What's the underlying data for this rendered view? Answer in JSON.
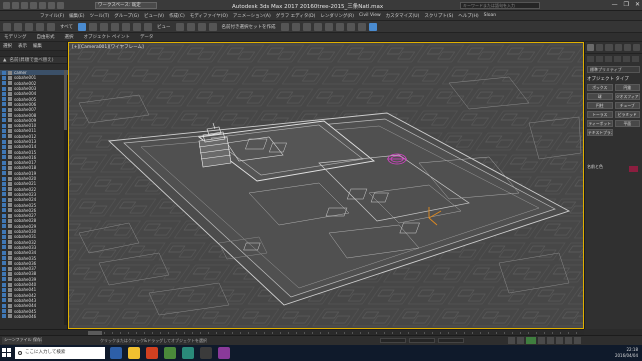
{
  "window": {
    "title": "Autodesk 3ds Max 2017    20160tree-2015_三条Natl.max",
    "workspace_label": "ワークスペース: 既定",
    "search_placeholder": "キーワードまたは語句を入力",
    "controls": [
      "—",
      "❐",
      "✕"
    ]
  },
  "menubar": {
    "items": [
      "ファイル(F)",
      "編集(E)",
      "ツール(T)",
      "グループ(G)",
      "ビュー(V)",
      "作成(C)",
      "モディファイヤ(O)",
      "アニメーション(A)",
      "グラフ エディタ(D)",
      "レンダリング(R)",
      "Civil View",
      "カスタマイズ(U)",
      "スクリプト(S)",
      "ヘルプ(H)",
      "Sloan"
    ]
  },
  "toolbar": {
    "selection_filter": "すべて",
    "view_label": "ビュー",
    "named_set": "名前付き選択セットを作成"
  },
  "ribbon": {
    "tabs": [
      "モデリング",
      "自由形式",
      "選択",
      "オブジェクト ペイント",
      "データ"
    ]
  },
  "scene_explorer": {
    "tabs": [
      "選択",
      "表示",
      "編集"
    ],
    "header": "名前(昇順で並べ替え)",
    "items": [
      "camer",
      "sobahe001",
      "sobahe002",
      "sobahe003",
      "sobahe004",
      "sobahe005",
      "sobahe006",
      "sobahe007",
      "sobahe008",
      "sobahe009",
      "sobahe010",
      "sobahe011",
      "sobahe012",
      "sobahe013",
      "sobahe014",
      "sobahe015",
      "sobahe016",
      "sobahe017",
      "sobahe018",
      "sobahe019",
      "sobahe020",
      "sobahe021",
      "sobahe022",
      "sobahe023",
      "sobahe024",
      "sobahe025",
      "sobahe026",
      "sobahe027",
      "sobahe028",
      "sobahe029",
      "sobahe030",
      "sobahe031",
      "sobahe032",
      "sobahe033",
      "sobahe034",
      "sobahe035",
      "sobahe036",
      "sobahe037",
      "sobahe038",
      "sobahe039",
      "sobahe040",
      "sobahe041",
      "sobahe042",
      "sobahe043",
      "sobahe044",
      "sobahe045",
      "sobahe046"
    ]
  },
  "viewport": {
    "label": "[+][Camera001][ワイヤフレーム]"
  },
  "command_panel": {
    "dropdown": "標準プリミティブ",
    "section_object_type": "オブジェクト タイプ",
    "buttons": [
      "ボックス",
      "円錐",
      "球",
      "ジオスフィア",
      "円柱",
      "チューブ",
      "トーラス",
      "ピラミッド",
      "ティーポット",
      "平面",
      "テキストプラス"
    ],
    "section_name_color": "名前と色"
  },
  "status": {
    "frame": "0 / 100",
    "mini_listener": "シーンファイル 保存済み",
    "hint": "クリックまたはクリック&ドラッグしてオブジェクトを選択"
  },
  "taskbar": {
    "search_text": "ここに入力して検索",
    "clock_time": "22:18",
    "clock_date": "2016/04/04",
    "app_colors": [
      "#2d5fa8",
      "#f0c030",
      "#d04020",
      "#4a8a3a",
      "#2a8a7a",
      "#3b3b3b",
      "#8a3a9a"
    ]
  },
  "colors": {
    "viewport_bg": "#454545",
    "wire": "#d8d8d8",
    "highlight_wire": "#e040d0",
    "orange_wire": "#e08a20",
    "viewport_border": "#e0b000"
  }
}
